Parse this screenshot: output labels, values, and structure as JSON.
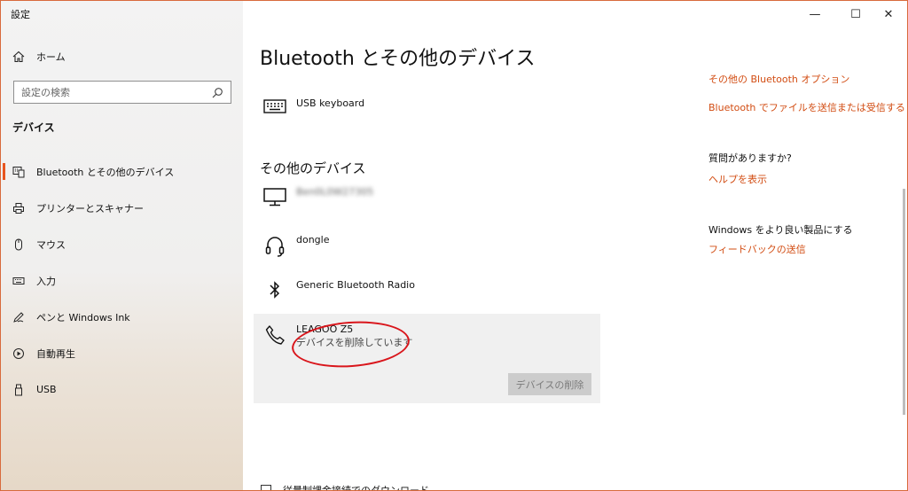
{
  "window": {
    "title": "設定",
    "controls": {
      "minimize": "—",
      "maximize": "☐",
      "close": "✕"
    }
  },
  "sidebar": {
    "home_label": "ホーム",
    "search_placeholder": "設定の検索",
    "section_title": "デバイス",
    "items": [
      {
        "label": "Bluetooth とその他のデバイス",
        "icon": "bluetooth-devices-icon",
        "active": true
      },
      {
        "label": "プリンターとスキャナー",
        "icon": "printer-icon"
      },
      {
        "label": "マウス",
        "icon": "mouse-icon"
      },
      {
        "label": "入力",
        "icon": "keyboard-icon"
      },
      {
        "label": "ペンと Windows Ink",
        "icon": "pen-icon"
      },
      {
        "label": "自動再生",
        "icon": "autoplay-icon"
      },
      {
        "label": "USB",
        "icon": "usb-icon"
      }
    ]
  },
  "main": {
    "title": "Bluetooth とその他のデバイス",
    "keyboard_device": "USB keyboard",
    "other_devices_title": "その他のデバイス",
    "devices": [
      {
        "name": "Ben0L0W27305",
        "icon": "monitor-icon"
      },
      {
        "name": "dongle",
        "icon": "headset-icon"
      },
      {
        "name": "Generic Bluetooth Radio",
        "icon": "bluetooth-icon"
      }
    ],
    "selected_device": {
      "name": "LEAGOO Z5",
      "status": "デバイスを削除しています",
      "remove_button": "デバイスの削除",
      "icon": "phone-icon"
    },
    "bottom_option": "従量制課金接続でのダウンロード"
  },
  "right": {
    "bt_options_link": "その他の Bluetooth オプション",
    "send_files_link": "Bluetooth でファイルを送信または受信する",
    "question": "質問がありますか?",
    "help_link": "ヘルプを表示",
    "improve_text": "Windows をより良い製品にする",
    "feedback_link": "フィードバックの送信"
  },
  "colors": {
    "accent": "#e8551f",
    "link": "#d24c12",
    "annotation": "#d9151b"
  }
}
